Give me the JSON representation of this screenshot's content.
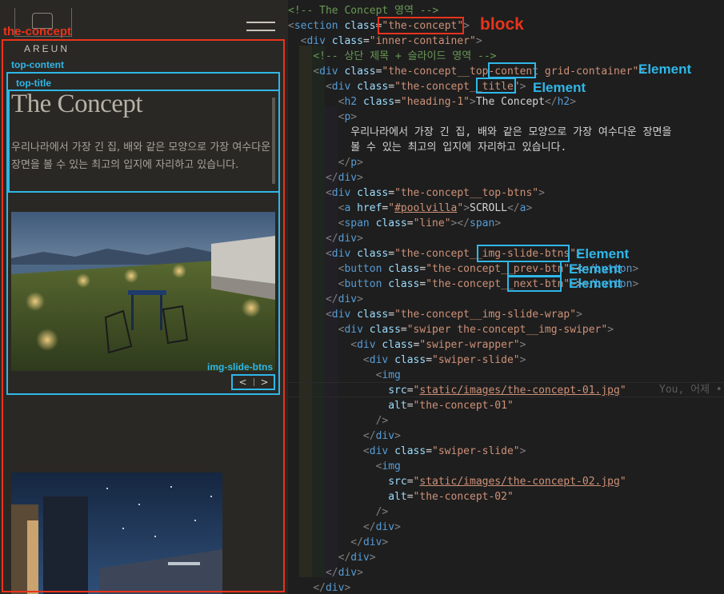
{
  "preview": {
    "brand": "AREUN",
    "concept_title": "The Concept",
    "concept_desc": "우리나라에서 가장 긴 집, 배와 같은 모양으로 가장 여수다운 장면을 볼 수 있는 최고의 입지에 자리하고 있습니다.",
    "prev_btn": "<",
    "next_btn": ">"
  },
  "annotations": {
    "the_concept": "the-concept",
    "block": "block",
    "top_content": "top-content",
    "top_title": "top-title",
    "img_slide_btns": "img-slide-btns",
    "element": "Element"
  },
  "editor": {
    "blame": "You, 어제 •",
    "lines": [
      [
        [
          "c-comment",
          "<!-- The Concept 영역 -->"
        ]
      ],
      [
        [
          "c-punct",
          "<"
        ],
        [
          "c-tag",
          "section"
        ],
        [
          "c-text",
          " "
        ],
        [
          "c-attr",
          "class"
        ],
        [
          "c-text",
          "="
        ],
        [
          "c-str",
          "\"the-concept\""
        ],
        [
          "c-punct",
          ">"
        ]
      ],
      [
        [
          "c-text",
          "  "
        ],
        [
          "c-punct",
          "<"
        ],
        [
          "c-tag",
          "div"
        ],
        [
          "c-text",
          " "
        ],
        [
          "c-attr",
          "class"
        ],
        [
          "c-text",
          "="
        ],
        [
          "c-str",
          "\"inner-container\""
        ],
        [
          "c-punct",
          ">"
        ]
      ],
      [
        [
          "c-text",
          "    "
        ],
        [
          "c-comment",
          "<!-- 상단 제목 + 슬라이드 영역 -->"
        ]
      ],
      [
        [
          "c-text",
          "    "
        ],
        [
          "c-punct",
          "<"
        ],
        [
          "c-tag",
          "div"
        ],
        [
          "c-text",
          " "
        ],
        [
          "c-attr",
          "class"
        ],
        [
          "c-text",
          "="
        ],
        [
          "c-str",
          "\"the-concept__top-content grid-container\""
        ],
        [
          "c-punct",
          ">"
        ]
      ],
      [
        [
          "c-text",
          "      "
        ],
        [
          "c-punct",
          "<"
        ],
        [
          "c-tag",
          "div"
        ],
        [
          "c-text",
          " "
        ],
        [
          "c-attr",
          "class"
        ],
        [
          "c-text",
          "="
        ],
        [
          "c-str",
          "\"the-concept__title\""
        ],
        [
          "c-punct",
          ">"
        ]
      ],
      [
        [
          "c-text",
          "        "
        ],
        [
          "c-punct",
          "<"
        ],
        [
          "c-tag",
          "h2"
        ],
        [
          "c-text",
          " "
        ],
        [
          "c-attr",
          "class"
        ],
        [
          "c-text",
          "="
        ],
        [
          "c-str",
          "\"heading-1\""
        ],
        [
          "c-punct",
          ">"
        ],
        [
          "c-text",
          "The Concept"
        ],
        [
          "c-punct",
          "</"
        ],
        [
          "c-tag",
          "h2"
        ],
        [
          "c-punct",
          ">"
        ]
      ],
      [
        [
          "c-text",
          "        "
        ],
        [
          "c-punct",
          "<"
        ],
        [
          "c-tag",
          "p"
        ],
        [
          "c-punct",
          ">"
        ]
      ],
      [
        [
          "c-text",
          "          우리나라에서 가장 긴 집, 배와 같은 모양으로 가장 여수다운 장면을"
        ]
      ],
      [
        [
          "c-text",
          "          볼 수 있는 최고의 입지에 자리하고 있습니다."
        ]
      ],
      [
        [
          "c-text",
          "        "
        ],
        [
          "c-punct",
          "</"
        ],
        [
          "c-tag",
          "p"
        ],
        [
          "c-punct",
          ">"
        ]
      ],
      [
        [
          "c-text",
          "      "
        ],
        [
          "c-punct",
          "</"
        ],
        [
          "c-tag",
          "div"
        ],
        [
          "c-punct",
          ">"
        ]
      ],
      [
        [
          "c-text",
          "      "
        ],
        [
          "c-punct",
          "<"
        ],
        [
          "c-tag",
          "div"
        ],
        [
          "c-text",
          " "
        ],
        [
          "c-attr",
          "class"
        ],
        [
          "c-text",
          "="
        ],
        [
          "c-str",
          "\"the-concept__top-btns\""
        ],
        [
          "c-punct",
          ">"
        ]
      ],
      [
        [
          "c-text",
          "        "
        ],
        [
          "c-punct",
          "<"
        ],
        [
          "c-tag",
          "a"
        ],
        [
          "c-text",
          " "
        ],
        [
          "c-attr",
          "href"
        ],
        [
          "c-text",
          "="
        ],
        [
          "c-str",
          "\""
        ],
        [
          "c-link",
          "#poolvilla"
        ],
        [
          "c-str",
          "\""
        ],
        [
          "c-punct",
          ">"
        ],
        [
          "c-text",
          "SCROLL"
        ],
        [
          "c-punct",
          "</"
        ],
        [
          "c-tag",
          "a"
        ],
        [
          "c-punct",
          ">"
        ]
      ],
      [
        [
          "c-text",
          "        "
        ],
        [
          "c-punct",
          "<"
        ],
        [
          "c-tag",
          "span"
        ],
        [
          "c-text",
          " "
        ],
        [
          "c-attr",
          "class"
        ],
        [
          "c-text",
          "="
        ],
        [
          "c-str",
          "\"line\""
        ],
        [
          "c-punct",
          "></"
        ],
        [
          "c-tag",
          "span"
        ],
        [
          "c-punct",
          ">"
        ]
      ],
      [
        [
          "c-text",
          "      "
        ],
        [
          "c-punct",
          "</"
        ],
        [
          "c-tag",
          "div"
        ],
        [
          "c-punct",
          ">"
        ]
      ],
      [
        [
          "c-text",
          "      "
        ],
        [
          "c-punct",
          "<"
        ],
        [
          "c-tag",
          "div"
        ],
        [
          "c-text",
          " "
        ],
        [
          "c-attr",
          "class"
        ],
        [
          "c-text",
          "="
        ],
        [
          "c-str",
          "\"the-concept__img-slide-btns\""
        ],
        [
          "c-punct",
          ">"
        ]
      ],
      [
        [
          "c-text",
          "        "
        ],
        [
          "c-punct",
          "<"
        ],
        [
          "c-tag",
          "button"
        ],
        [
          "c-text",
          " "
        ],
        [
          "c-attr",
          "class"
        ],
        [
          "c-text",
          "="
        ],
        [
          "c-str",
          "\"the-concept__prev-btn\""
        ],
        [
          "c-punct",
          ">"
        ],
        [
          "c-text",
          "&lt;"
        ],
        [
          "c-punct",
          "</"
        ],
        [
          "c-tag",
          "button"
        ],
        [
          "c-punct",
          ">"
        ]
      ],
      [
        [
          "c-text",
          "        "
        ],
        [
          "c-punct",
          "<"
        ],
        [
          "c-tag",
          "button"
        ],
        [
          "c-text",
          " "
        ],
        [
          "c-attr",
          "class"
        ],
        [
          "c-text",
          "="
        ],
        [
          "c-str",
          "\"the-concept__next-btn\""
        ],
        [
          "c-punct",
          ">"
        ],
        [
          "c-text",
          "&gt;"
        ],
        [
          "c-punct",
          "</"
        ],
        [
          "c-tag",
          "button"
        ],
        [
          "c-punct",
          ">"
        ]
      ],
      [
        [
          "c-text",
          "      "
        ],
        [
          "c-punct",
          "</"
        ],
        [
          "c-tag",
          "div"
        ],
        [
          "c-punct",
          ">"
        ]
      ],
      [
        [
          "c-text",
          "      "
        ],
        [
          "c-punct",
          "<"
        ],
        [
          "c-tag",
          "div"
        ],
        [
          "c-text",
          " "
        ],
        [
          "c-attr",
          "class"
        ],
        [
          "c-text",
          "="
        ],
        [
          "c-str",
          "\"the-concept__img-slide-wrap\""
        ],
        [
          "c-punct",
          ">"
        ]
      ],
      [
        [
          "c-text",
          "        "
        ],
        [
          "c-punct",
          "<"
        ],
        [
          "c-tag",
          "div"
        ],
        [
          "c-text",
          " "
        ],
        [
          "c-attr",
          "class"
        ],
        [
          "c-text",
          "="
        ],
        [
          "c-str",
          "\"swiper the-concept__img-swiper\""
        ],
        [
          "c-punct",
          ">"
        ]
      ],
      [
        [
          "c-text",
          "          "
        ],
        [
          "c-punct",
          "<"
        ],
        [
          "c-tag",
          "div"
        ],
        [
          "c-text",
          " "
        ],
        [
          "c-attr",
          "class"
        ],
        [
          "c-text",
          "="
        ],
        [
          "c-str",
          "\"swiper-wrapper\""
        ],
        [
          "c-punct",
          ">"
        ]
      ],
      [
        [
          "c-text",
          "            "
        ],
        [
          "c-punct",
          "<"
        ],
        [
          "c-tag",
          "div"
        ],
        [
          "c-text",
          " "
        ],
        [
          "c-attr",
          "class"
        ],
        [
          "c-text",
          "="
        ],
        [
          "c-str",
          "\"swiper-slide\""
        ],
        [
          "c-punct",
          ">"
        ]
      ],
      [
        [
          "c-text",
          "              "
        ],
        [
          "c-punct",
          "<"
        ],
        [
          "c-tag",
          "img"
        ]
      ],
      [
        [
          "c-text",
          "                "
        ],
        [
          "c-attr",
          "src"
        ],
        [
          "c-text",
          "="
        ],
        [
          "c-str",
          "\""
        ],
        [
          "c-link",
          "static/images/the-concept-01.jpg"
        ],
        [
          "c-str",
          "\""
        ]
      ],
      [
        [
          "c-text",
          "                "
        ],
        [
          "c-attr",
          "alt"
        ],
        [
          "c-text",
          "="
        ],
        [
          "c-str",
          "\"the-concept-01\""
        ]
      ],
      [
        [
          "c-text",
          "              "
        ],
        [
          "c-punct",
          "/>"
        ]
      ],
      [
        [
          "c-text",
          "            "
        ],
        [
          "c-punct",
          "</"
        ],
        [
          "c-tag",
          "div"
        ],
        [
          "c-punct",
          ">"
        ]
      ],
      [
        [
          "c-text",
          "            "
        ],
        [
          "c-punct",
          "<"
        ],
        [
          "c-tag",
          "div"
        ],
        [
          "c-text",
          " "
        ],
        [
          "c-attr",
          "class"
        ],
        [
          "c-text",
          "="
        ],
        [
          "c-str",
          "\"swiper-slide\""
        ],
        [
          "c-punct",
          ">"
        ]
      ],
      [
        [
          "c-text",
          "              "
        ],
        [
          "c-punct",
          "<"
        ],
        [
          "c-tag",
          "img"
        ]
      ],
      [
        [
          "c-text",
          "                "
        ],
        [
          "c-attr",
          "src"
        ],
        [
          "c-text",
          "="
        ],
        [
          "c-str",
          "\""
        ],
        [
          "c-link",
          "static/images/the-concept-02.jpg"
        ],
        [
          "c-str",
          "\""
        ]
      ],
      [
        [
          "c-text",
          "                "
        ],
        [
          "c-attr",
          "alt"
        ],
        [
          "c-text",
          "="
        ],
        [
          "c-str",
          "\"the-concept-02\""
        ]
      ],
      [
        [
          "c-text",
          "              "
        ],
        [
          "c-punct",
          "/>"
        ]
      ],
      [
        [
          "c-text",
          "            "
        ],
        [
          "c-punct",
          "</"
        ],
        [
          "c-tag",
          "div"
        ],
        [
          "c-punct",
          ">"
        ]
      ],
      [
        [
          "c-text",
          "          "
        ],
        [
          "c-punct",
          "</"
        ],
        [
          "c-tag",
          "div"
        ],
        [
          "c-punct",
          ">"
        ]
      ],
      [
        [
          "c-text",
          "        "
        ],
        [
          "c-punct",
          "</"
        ],
        [
          "c-tag",
          "div"
        ],
        [
          "c-punct",
          ">"
        ]
      ],
      [
        [
          "c-text",
          "      "
        ],
        [
          "c-punct",
          "</"
        ],
        [
          "c-tag",
          "div"
        ],
        [
          "c-punct",
          ">"
        ]
      ],
      [
        [
          "c-text",
          "    "
        ],
        [
          "c-punct",
          "</"
        ],
        [
          "c-tag",
          "div"
        ],
        [
          "c-punct",
          ">"
        ]
      ]
    ]
  }
}
